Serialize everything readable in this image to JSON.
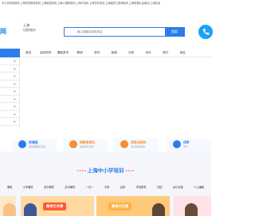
{
  "topbar": {
    "line1": "中小学培训机构,上海学历教育培训,上海英语培训,上海小语种培训,上海IT培训,上海艺考培训,上海建筑工程师培训,上海资格认证培训,上海高品",
    "line2": ""
  },
  "header": {
    "logo": "网",
    "city": "上海",
    "switch_city": "切换城市",
    "search_type": "课程",
    "search_placeholder": "输入课程名或机构名",
    "search_button": "搜索",
    "hotline_icon": "phone-icon"
  },
  "nav": {
    "items": [
      "首页",
      "培训学校",
      "课程资讯",
      "教师",
      "资讯",
      "新闻",
      "问答",
      "评价",
      "排行",
      "地址"
    ]
  },
  "sidebar": {
    "rows": [
      ">",
      ">",
      ">",
      ">",
      ">",
      ">",
      ">",
      ">",
      ">"
    ]
  },
  "quicklinks": [
    {
      "title": "找课程",
      "sub": "海量课程任您选"
    },
    {
      "title": "找教育资讯",
      "sub": "最新教育资讯"
    },
    {
      "title": "找培训机构",
      "sub": "专业培训机构"
    },
    {
      "title": "找学",
      "sub": "学习"
    }
  ],
  "section": {
    "title": "上海中小学培训",
    "tabs": [
      "课程",
      "小学辅导",
      "初中辅导",
      "高中辅导",
      "一对一",
      "中考",
      "高考",
      "学前教育",
      "托班",
      "幼小衔接",
      "少儿编程",
      "少儿英语",
      "作文",
      "少儿美术"
    ],
    "cards": [
      {
        "label": ""
      },
      {
        "label": "高考艺术课"
      },
      {
        "label": "高考文化课"
      },
      {
        "label": ""
      }
    ]
  },
  "colors": {
    "accent": "#2b7de9",
    "orange": "#f58e2b",
    "red": "#ff4d4f"
  }
}
